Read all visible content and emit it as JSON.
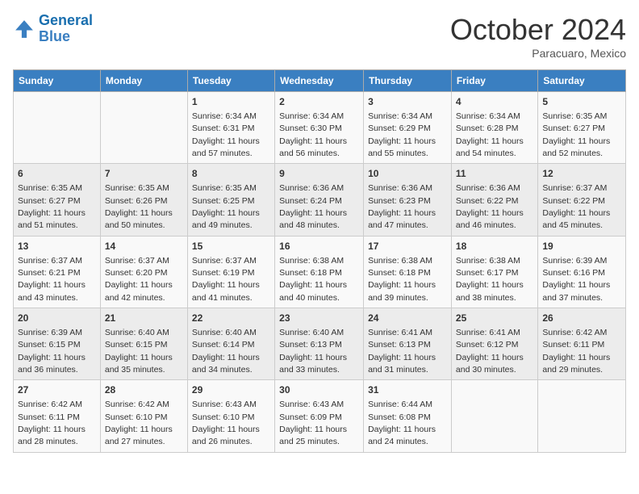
{
  "header": {
    "logo_line1": "General",
    "logo_line2": "Blue",
    "month": "October 2024",
    "location": "Paracuaro, Mexico"
  },
  "weekdays": [
    "Sunday",
    "Monday",
    "Tuesday",
    "Wednesday",
    "Thursday",
    "Friday",
    "Saturday"
  ],
  "weeks": [
    [
      {
        "day": "",
        "info": ""
      },
      {
        "day": "",
        "info": ""
      },
      {
        "day": "1",
        "info": "Sunrise: 6:34 AM\nSunset: 6:31 PM\nDaylight: 11 hours and 57 minutes."
      },
      {
        "day": "2",
        "info": "Sunrise: 6:34 AM\nSunset: 6:30 PM\nDaylight: 11 hours and 56 minutes."
      },
      {
        "day": "3",
        "info": "Sunrise: 6:34 AM\nSunset: 6:29 PM\nDaylight: 11 hours and 55 minutes."
      },
      {
        "day": "4",
        "info": "Sunrise: 6:34 AM\nSunset: 6:28 PM\nDaylight: 11 hours and 54 minutes."
      },
      {
        "day": "5",
        "info": "Sunrise: 6:35 AM\nSunset: 6:27 PM\nDaylight: 11 hours and 52 minutes."
      }
    ],
    [
      {
        "day": "6",
        "info": "Sunrise: 6:35 AM\nSunset: 6:27 PM\nDaylight: 11 hours and 51 minutes."
      },
      {
        "day": "7",
        "info": "Sunrise: 6:35 AM\nSunset: 6:26 PM\nDaylight: 11 hours and 50 minutes."
      },
      {
        "day": "8",
        "info": "Sunrise: 6:35 AM\nSunset: 6:25 PM\nDaylight: 11 hours and 49 minutes."
      },
      {
        "day": "9",
        "info": "Sunrise: 6:36 AM\nSunset: 6:24 PM\nDaylight: 11 hours and 48 minutes."
      },
      {
        "day": "10",
        "info": "Sunrise: 6:36 AM\nSunset: 6:23 PM\nDaylight: 11 hours and 47 minutes."
      },
      {
        "day": "11",
        "info": "Sunrise: 6:36 AM\nSunset: 6:22 PM\nDaylight: 11 hours and 46 minutes."
      },
      {
        "day": "12",
        "info": "Sunrise: 6:37 AM\nSunset: 6:22 PM\nDaylight: 11 hours and 45 minutes."
      }
    ],
    [
      {
        "day": "13",
        "info": "Sunrise: 6:37 AM\nSunset: 6:21 PM\nDaylight: 11 hours and 43 minutes."
      },
      {
        "day": "14",
        "info": "Sunrise: 6:37 AM\nSunset: 6:20 PM\nDaylight: 11 hours and 42 minutes."
      },
      {
        "day": "15",
        "info": "Sunrise: 6:37 AM\nSunset: 6:19 PM\nDaylight: 11 hours and 41 minutes."
      },
      {
        "day": "16",
        "info": "Sunrise: 6:38 AM\nSunset: 6:18 PM\nDaylight: 11 hours and 40 minutes."
      },
      {
        "day": "17",
        "info": "Sunrise: 6:38 AM\nSunset: 6:18 PM\nDaylight: 11 hours and 39 minutes."
      },
      {
        "day": "18",
        "info": "Sunrise: 6:38 AM\nSunset: 6:17 PM\nDaylight: 11 hours and 38 minutes."
      },
      {
        "day": "19",
        "info": "Sunrise: 6:39 AM\nSunset: 6:16 PM\nDaylight: 11 hours and 37 minutes."
      }
    ],
    [
      {
        "day": "20",
        "info": "Sunrise: 6:39 AM\nSunset: 6:15 PM\nDaylight: 11 hours and 36 minutes."
      },
      {
        "day": "21",
        "info": "Sunrise: 6:40 AM\nSunset: 6:15 PM\nDaylight: 11 hours and 35 minutes."
      },
      {
        "day": "22",
        "info": "Sunrise: 6:40 AM\nSunset: 6:14 PM\nDaylight: 11 hours and 34 minutes."
      },
      {
        "day": "23",
        "info": "Sunrise: 6:40 AM\nSunset: 6:13 PM\nDaylight: 11 hours and 33 minutes."
      },
      {
        "day": "24",
        "info": "Sunrise: 6:41 AM\nSunset: 6:13 PM\nDaylight: 11 hours and 31 minutes."
      },
      {
        "day": "25",
        "info": "Sunrise: 6:41 AM\nSunset: 6:12 PM\nDaylight: 11 hours and 30 minutes."
      },
      {
        "day": "26",
        "info": "Sunrise: 6:42 AM\nSunset: 6:11 PM\nDaylight: 11 hours and 29 minutes."
      }
    ],
    [
      {
        "day": "27",
        "info": "Sunrise: 6:42 AM\nSunset: 6:11 PM\nDaylight: 11 hours and 28 minutes."
      },
      {
        "day": "28",
        "info": "Sunrise: 6:42 AM\nSunset: 6:10 PM\nDaylight: 11 hours and 27 minutes."
      },
      {
        "day": "29",
        "info": "Sunrise: 6:43 AM\nSunset: 6:10 PM\nDaylight: 11 hours and 26 minutes."
      },
      {
        "day": "30",
        "info": "Sunrise: 6:43 AM\nSunset: 6:09 PM\nDaylight: 11 hours and 25 minutes."
      },
      {
        "day": "31",
        "info": "Sunrise: 6:44 AM\nSunset: 6:08 PM\nDaylight: 11 hours and 24 minutes."
      },
      {
        "day": "",
        "info": ""
      },
      {
        "day": "",
        "info": ""
      }
    ]
  ]
}
